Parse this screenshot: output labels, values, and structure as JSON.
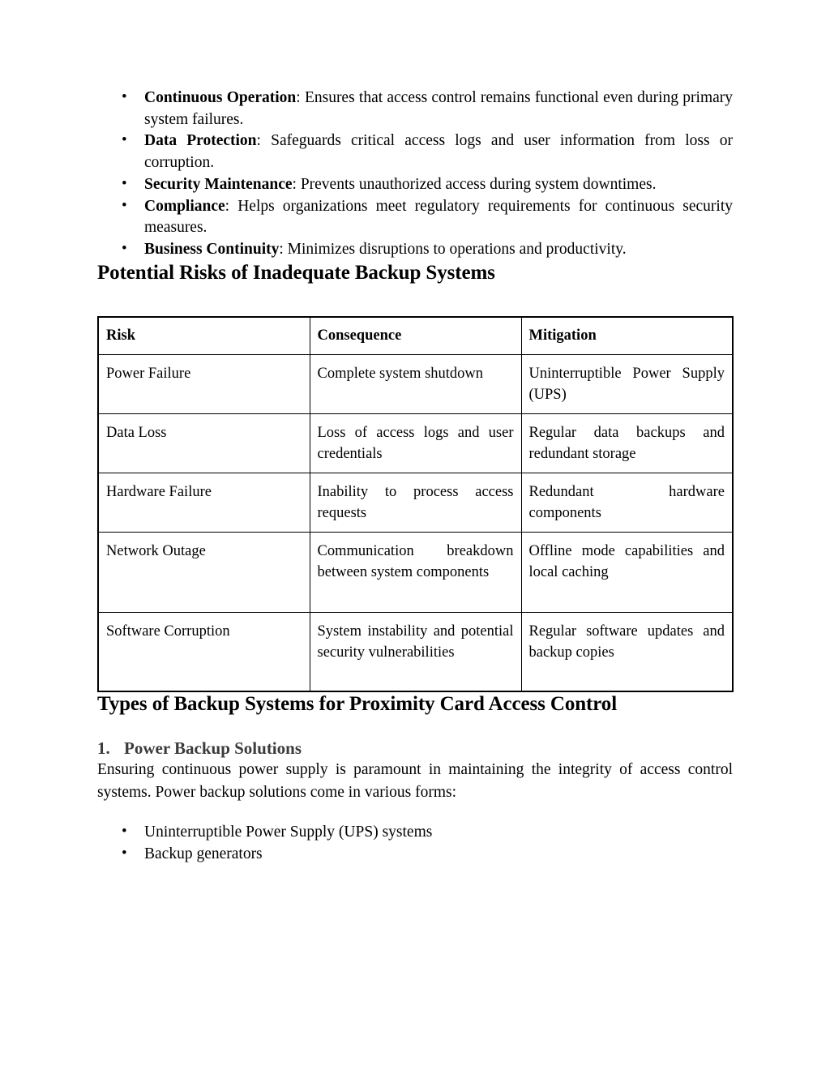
{
  "document": {
    "benefits_list": [
      {
        "term": "Continuous Operation",
        "separator": ": ",
        "text": "Ensures that access control remains functional even during primary system failures."
      },
      {
        "term": "Data Protection",
        "separator": ": ",
        "text": "Safeguards critical access logs and user information from loss or corruption."
      },
      {
        "term": "Security Maintenance",
        "separator": ": ",
        "text": "Prevents unauthorized access during system downtimes."
      },
      {
        "term": "Compliance",
        "separator": ": ",
        "text": "Helps organizations meet regulatory requirements for continuous security measures."
      },
      {
        "term": "Business Continuity",
        "separator": ": ",
        "text": "Minimizes disruptions to operations and productivity."
      }
    ],
    "risks_heading": "Potential Risks of Inadequate Backup Systems",
    "risk_table": {
      "headers": [
        "Risk",
        "Consequence",
        "Mitigation"
      ],
      "rows": [
        {
          "risk": "Power Failure",
          "consequence": "Complete system shutdown",
          "mitigation": "Uninterruptible Power Supply (UPS)"
        },
        {
          "risk": "Data Loss",
          "consequence": "Loss of access logs and user credentials",
          "mitigation": "Regular data backups and redundant storage"
        },
        {
          "risk": "Hardware Failure",
          "consequence": "Inability to process access requests",
          "mitigation": "Redundant hardware components"
        },
        {
          "risk": "Network Outage",
          "consequence": "Communication breakdown between system components",
          "mitigation": "Offline mode capabilities and local caching"
        },
        {
          "risk": "Software Corruption",
          "consequence": "System instability and potential security vulnerabilities",
          "mitigation": "Regular software updates and backup copies"
        }
      ]
    },
    "types_heading": "Types of Backup Systems for Proximity Card Access Control",
    "power_subheading": {
      "number": "1.",
      "label": "Power Backup Solutions"
    },
    "power_paragraph": "Ensuring continuous power supply is paramount in maintaining the integrity of access control systems. Power backup solutions come in various forms:",
    "power_list": [
      "Uninterruptible Power Supply (UPS) systems",
      "Backup generators"
    ]
  }
}
